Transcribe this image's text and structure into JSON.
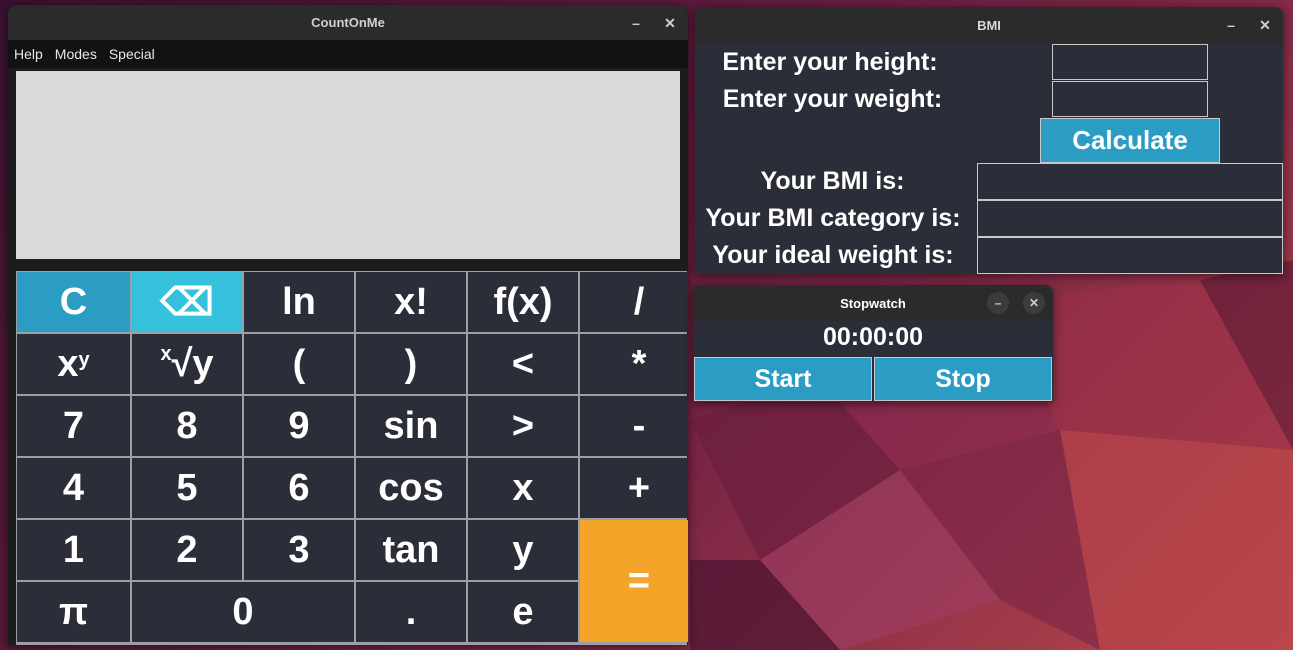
{
  "calculator": {
    "title": "CountOnMe",
    "menu": [
      "Help",
      "Modes",
      "Special"
    ],
    "display_value": "",
    "keys": {
      "clear": "C",
      "backspace": "⌫",
      "ln": "ln",
      "factorial": "x!",
      "fx": "f(x)",
      "divide": "/",
      "power_base": "x",
      "power_exp": "y",
      "root_pre": "x",
      "root_body": "√y",
      "lparen": "(",
      "rparen": ")",
      "lt": "<",
      "multiply": "*",
      "d7": "7",
      "d8": "8",
      "d9": "9",
      "sin": "sin",
      "gt": ">",
      "minus": "-",
      "d4": "4",
      "d5": "5",
      "d6": "6",
      "cos": "cos",
      "x": "x",
      "plus": "+",
      "d1": "1",
      "d2": "2",
      "d3": "3",
      "tan": "tan",
      "y": "y",
      "equals": "=",
      "pi": "π",
      "d0": "0",
      "dot": ".",
      "e": "e"
    }
  },
  "bmi": {
    "title": "BMI",
    "height_label": "Enter your height:",
    "weight_label": "Enter your weight:",
    "calculate": "Calculate",
    "bmi_label": "Your BMI is:",
    "category_label": "Your BMI category is:",
    "ideal_label": "Your ideal weight is:"
  },
  "stopwatch": {
    "title": "Stopwatch",
    "time": "00:00:00",
    "start": "Start",
    "stop": "Stop"
  },
  "window_controls": {
    "minimize": "–",
    "close": "✕"
  },
  "colors": {
    "accent_blue": "#2b9cc4",
    "backspace_cyan": "#35c1dc",
    "equals_orange": "#f5a42a",
    "key_dark": "#2b2e38"
  }
}
